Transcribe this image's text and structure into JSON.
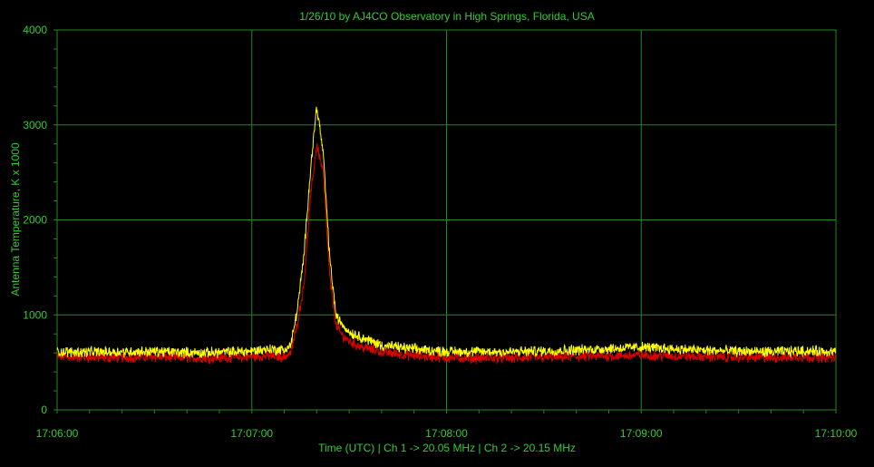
{
  "chart_data": {
    "type": "line",
    "title": "1/26/10  by  AJ4CO Observatory  in  High Springs, Florida, USA",
    "xlabel": "Time (UTC)  |  Ch 1 -> 20.05 MHz  |  Ch 2 -> 20.15 MHz",
    "ylabel": "Antenna Temperature, K x 1000",
    "xlim": [
      "17:06:00",
      "17:10:00"
    ],
    "ylim": [
      0,
      4000
    ],
    "x_ticks": [
      "17:06:00",
      "17:07:00",
      "17:08:00",
      "17:09:00",
      "17:10:00"
    ],
    "y_ticks": [
      0,
      1000,
      2000,
      3000,
      4000
    ],
    "grid": true,
    "colors": {
      "background": "#000000",
      "text": "#33cc33",
      "grid": "#1f8a1f"
    },
    "series": [
      {
        "color": "#dd0000",
        "x": [
          "17:06:00",
          "17:06:15",
          "17:06:30",
          "17:06:45",
          "17:07:00",
          "17:07:05",
          "17:07:10",
          "17:07:12",
          "17:07:14",
          "17:07:16",
          "17:07:18",
          "17:07:20",
          "17:07:22",
          "17:07:24",
          "17:07:26",
          "17:07:28",
          "17:07:30",
          "17:07:34",
          "17:07:40",
          "17:07:50",
          "17:08:00",
          "17:08:20",
          "17:08:40",
          "17:09:00",
          "17:09:20",
          "17:09:40",
          "17:09:50",
          "17:10:00"
        ],
        "values": [
          560,
          550,
          560,
          545,
          560,
          570,
          560,
          600,
          900,
          1300,
          2200,
          2800,
          2500,
          1400,
          880,
          780,
          720,
          660,
          610,
          570,
          550,
          545,
          560,
          575,
          560,
          550,
          560,
          550
        ]
      },
      {
        "color": "#ffff00",
        "x": [
          "17:06:00",
          "17:06:15",
          "17:06:30",
          "17:06:45",
          "17:07:00",
          "17:07:05",
          "17:07:10",
          "17:07:12",
          "17:07:14",
          "17:07:16",
          "17:07:18",
          "17:07:20",
          "17:07:22",
          "17:07:24",
          "17:07:26",
          "17:07:28",
          "17:07:30",
          "17:07:34",
          "17:07:40",
          "17:07:50",
          "17:08:00",
          "17:08:20",
          "17:08:40",
          "17:09:00",
          "17:09:20",
          "17:09:40",
          "17:09:50",
          "17:10:00"
        ],
        "values": [
          610,
          610,
          615,
          600,
          620,
          640,
          630,
          680,
          1050,
          1600,
          2500,
          3200,
          2700,
          1600,
          980,
          900,
          820,
          760,
          680,
          640,
          615,
          610,
          630,
          660,
          625,
          610,
          620,
          615
        ]
      }
    ]
  }
}
